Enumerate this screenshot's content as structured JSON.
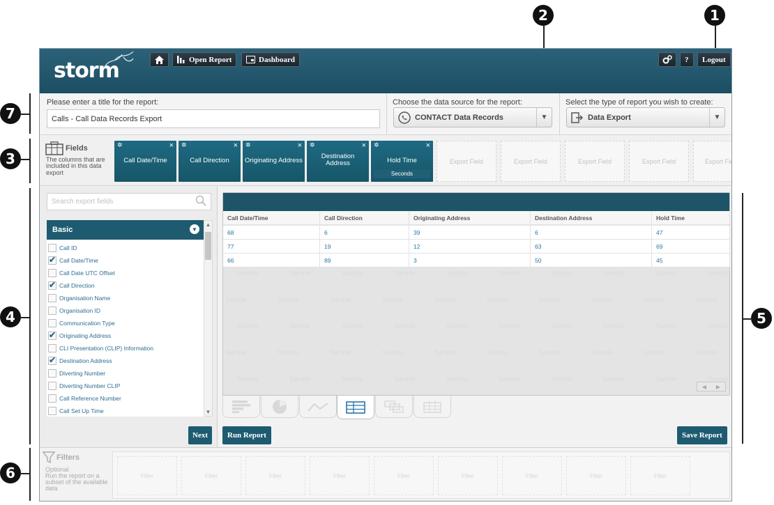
{
  "header": {
    "logo_text": "storm",
    "home_icon": "home-icon",
    "open_report_label": "Open Report",
    "dashboard_label": "Dashboard",
    "help_label": "?",
    "logout_label": "Logout"
  },
  "title_section": {
    "prompt": "Please enter a title for the report:",
    "value": "Calls - Call Data Records Export"
  },
  "datasource": {
    "prompt": "Choose the data source for the report:",
    "selected": "CONTACT Data Records"
  },
  "report_type": {
    "prompt": "Select the type of report you wish to create:",
    "selected": "Data Export"
  },
  "fields": {
    "heading": "Fields",
    "description": "The columns that are included in this data export",
    "selected": [
      {
        "label": "Call Date/Time",
        "sub": ""
      },
      {
        "label": "Call Direction",
        "sub": ""
      },
      {
        "label": "Originating Address",
        "sub": ""
      },
      {
        "label": "Destination Address",
        "sub": ""
      },
      {
        "label": "Hold Time",
        "sub": "Seconds"
      }
    ],
    "placeholders": [
      "Export Field",
      "Export Field",
      "Export Field",
      "Export Field",
      "Export Field"
    ]
  },
  "sidebar": {
    "search_placeholder": "Search export fields",
    "group_label": "Basic",
    "items": [
      {
        "label": "Call ID",
        "checked": false
      },
      {
        "label": "Call Date/Time",
        "checked": true
      },
      {
        "label": "Call Date UTC Offset",
        "checked": false
      },
      {
        "label": "Call Direction",
        "checked": true
      },
      {
        "label": "Organisation Name",
        "checked": false
      },
      {
        "label": "Organisation ID",
        "checked": false
      },
      {
        "label": "Communication Type",
        "checked": false
      },
      {
        "label": "Originating Address",
        "checked": true
      },
      {
        "label": "CLI Presentation (CLIP) Information",
        "checked": false
      },
      {
        "label": "Destination Address",
        "checked": true
      },
      {
        "label": "Diverting Number",
        "checked": false
      },
      {
        "label": "Diverting Number CLIP",
        "checked": false
      },
      {
        "label": "Call Reference Number",
        "checked": false
      },
      {
        "label": "Call Set Up Time",
        "checked": false
      }
    ],
    "next_label": "Next"
  },
  "preview": {
    "columns": [
      "Call Date/Time",
      "Call Direction",
      "Originating Address",
      "Destination Address",
      "Hold Time"
    ],
    "rows": [
      [
        "68",
        "6",
        "39",
        "6",
        "47"
      ],
      [
        "77",
        "19",
        "12",
        "63",
        "69"
      ],
      [
        "66",
        "89",
        "3",
        "50",
        "45"
      ]
    ],
    "watermark": "Sample",
    "view_icons": [
      "bar-chart-icon",
      "pie-chart-icon",
      "line-chart-icon",
      "table-icon",
      "pivot-icon",
      "grid-icon"
    ]
  },
  "actions": {
    "run_label": "Run Report",
    "save_label": "Save Report"
  },
  "filters": {
    "heading": "Filters",
    "description": "Optional\nRun the report on a subset of the available data",
    "slot_label": "Filter"
  },
  "callouts": [
    "1",
    "2",
    "3",
    "4",
    "5",
    "6",
    "7"
  ],
  "colors": {
    "primary": "#1e5b71",
    "header": "#235a70",
    "link": "#2d6d92"
  }
}
